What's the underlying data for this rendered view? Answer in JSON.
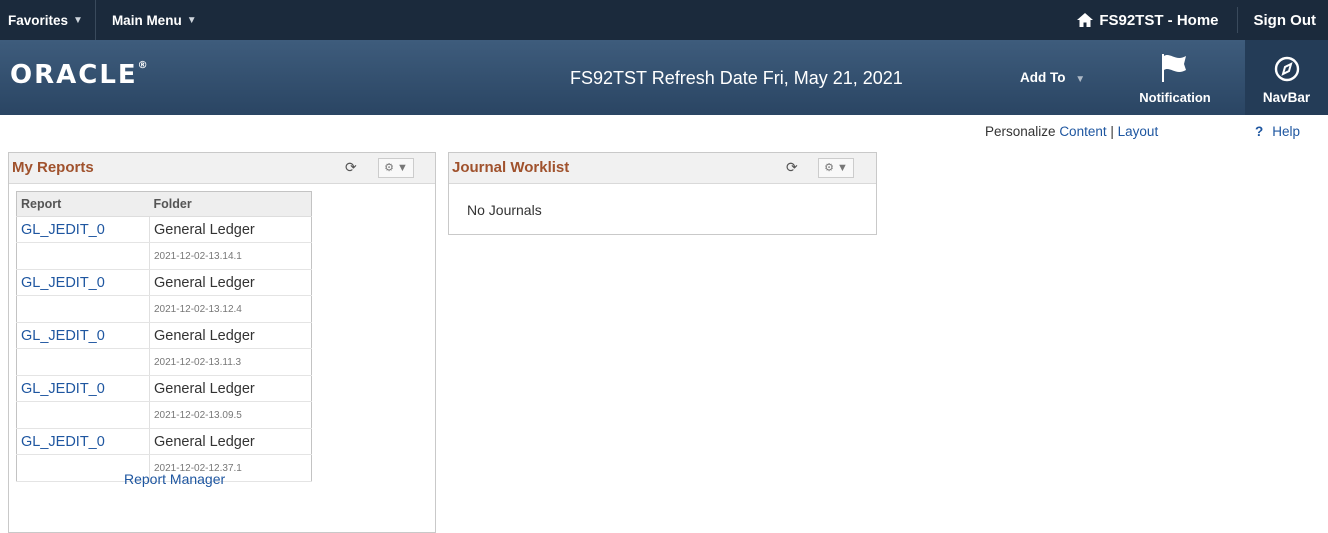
{
  "topbar": {
    "favorites_label": "Favorites",
    "main_menu_label": "Main Menu",
    "home_label": "FS92TST - Home",
    "signout_label": "Sign Out"
  },
  "banner": {
    "logo_text": "ORACLE",
    "logo_mark": "®",
    "refresh_text": "FS92TST Refresh Date Fri, May 21, 2021",
    "add_to_label": "Add To",
    "notification_label": "Notification",
    "navbar_label": "NavBar"
  },
  "links": {
    "personalize": "Personalize",
    "content": "Content",
    "separator": "|",
    "layout": "Layout",
    "help_icon": "?",
    "help": "Help"
  },
  "my_reports": {
    "title": "My Reports",
    "columns": [
      "Report",
      "Folder"
    ],
    "rows": [
      {
        "report": "GL_JEDIT_0",
        "folder": "General Ledger",
        "timestamp": "2021-12-02-13.14.1"
      },
      {
        "report": "GL_JEDIT_0",
        "folder": "General Ledger",
        "timestamp": "2021-12-02-13.12.4"
      },
      {
        "report": "GL_JEDIT_0",
        "folder": "General Ledger",
        "timestamp": "2021-12-02-13.11.3"
      },
      {
        "report": "GL_JEDIT_0",
        "folder": "General Ledger",
        "timestamp": "2021-12-02-13.09.5"
      },
      {
        "report": "GL_JEDIT_0",
        "folder": "General Ledger",
        "timestamp": "2021-12-02-12.37.1"
      }
    ],
    "report_manager_link": "Report Manager"
  },
  "journal_worklist": {
    "title": "Journal Worklist",
    "empty_text": "No Journals"
  },
  "colors": {
    "topbar_bg": "#1b2a3c",
    "banner_bg": "#2f4d6d",
    "pagelet_title": "#a0522d",
    "link": "#1e56a0"
  },
  "icons": {
    "home": "home-icon",
    "notification": "flag-icon",
    "navbar": "compass-icon",
    "refresh": "refresh-icon",
    "gear": "gear-icon"
  }
}
